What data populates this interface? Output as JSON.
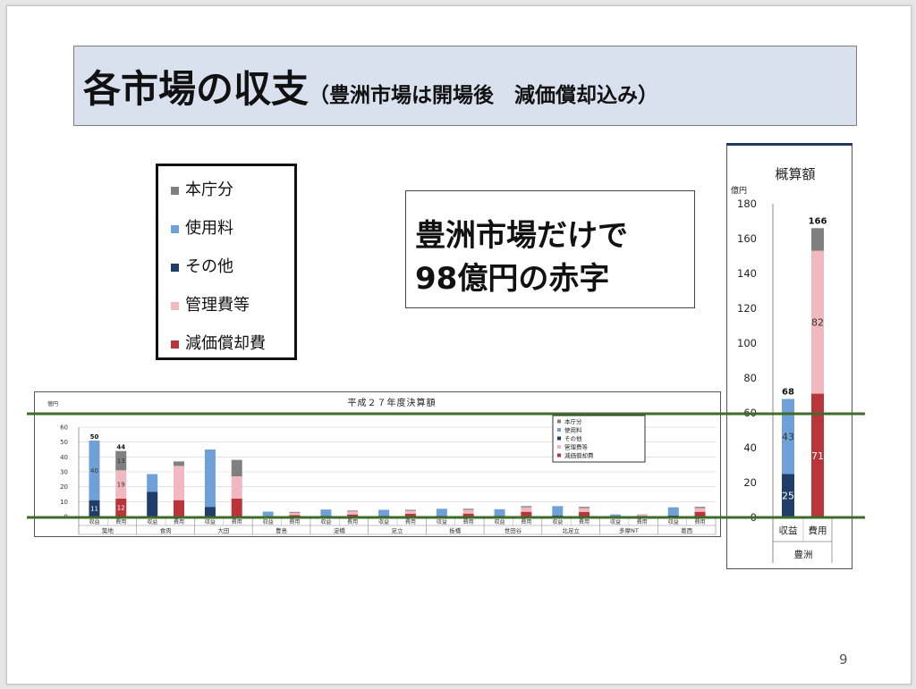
{
  "title": {
    "main": "各市場の収支",
    "sub": "（豊洲市場は開場後　減価償却込み）"
  },
  "legend": {
    "items": [
      {
        "label": "本庁分",
        "color": "#7f7f7f"
      },
      {
        "label": "使用料",
        "color": "#6fa0d8"
      },
      {
        "label": "その他",
        "color": "#1f3d66"
      },
      {
        "label": "管理費等",
        "color": "#f1b9bf"
      },
      {
        "label": "減価償却費",
        "color": "#b9353a"
      }
    ]
  },
  "callout": {
    "line1": "豊洲市場だけで",
    "line2": "98億円の赤字"
  },
  "page_number": "9",
  "chart_data": [
    {
      "type": "bar",
      "stacked": true,
      "title": "平成２７年度決算額",
      "unit": "億円",
      "ylim": [
        0,
        60
      ],
      "yticks": [
        0,
        10,
        20,
        30,
        40,
        50,
        60
      ],
      "yticklabels": [
        "0",
        "10",
        "20",
        "30",
        "40",
        "50",
        "60"
      ],
      "legend": [
        "本庁分",
        "使用料",
        "その他",
        "管理費等",
        "減価償却費"
      ],
      "bar_labels": [
        "収益",
        "費用"
      ],
      "markets": [
        {
          "name": "築地",
          "revenue": {
            "その他": 11,
            "使用料": 40
          },
          "expense": {
            "減価償却費": 12,
            "管理費等": 19,
            "本庁分": 13
          },
          "revenue_total": "50",
          "expense_total": "44",
          "segment_labels": {
            "revenue": {
              "その他": "11",
              "使用料": "40"
            },
            "expense": {
              "減価償却費": "12",
              "管理費等": "19",
              "本庁分": "13"
            }
          }
        },
        {
          "name": "食肉",
          "revenue": {
            "その他": 16.5,
            "使用料": 12
          },
          "expense": {
            "減価償却費": 11,
            "管理費等": 23,
            "本庁分": 3
          }
        },
        {
          "name": "大田",
          "revenue": {
            "その他": 6.5,
            "使用料": 38.5
          },
          "expense": {
            "減価償却費": 12,
            "管理費等": 15,
            "本庁分": 11
          }
        },
        {
          "name": "豊島",
          "revenue": {
            "その他": 0.4,
            "使用料": 2.9
          },
          "expense": {
            "減価償却費": 1,
            "管理費等": 1.5,
            "本庁分": 0.6
          }
        },
        {
          "name": "淀橋",
          "revenue": {
            "その他": 0.5,
            "使用料": 4.2
          },
          "expense": {
            "減価償却費": 1.4,
            "管理費等": 2,
            "本庁分": 0.6
          }
        },
        {
          "name": "足立",
          "revenue": {
            "その他": 0.5,
            "使用料": 4
          },
          "expense": {
            "減価償却費": 1.8,
            "管理費等": 2.1,
            "本庁分": 0.6
          }
        },
        {
          "name": "板橋",
          "revenue": {
            "その他": 0.5,
            "使用料": 4.7
          },
          "expense": {
            "減価償却費": 2,
            "管理費等": 2.5,
            "本庁分": 0.7
          }
        },
        {
          "name": "世田谷",
          "revenue": {
            "その他": 0.5,
            "使用料": 4.4
          },
          "expense": {
            "減価償却費": 3.2,
            "管理費等": 3,
            "本庁分": 0.8
          }
        },
        {
          "name": "北足立",
          "revenue": {
            "その他": 0.6,
            "使用料": 6.4
          },
          "expense": {
            "減価償却費": 3,
            "管理費等": 2.7,
            "本庁分": 0.8
          }
        },
        {
          "name": "多摩NT",
          "revenue": {
            "その他": 0.2,
            "使用料": 1.2
          },
          "expense": {
            "減価償却費": 0.5,
            "管理費等": 0.7,
            "本庁分": 0.2
          }
        },
        {
          "name": "葛西",
          "revenue": {
            "その他": 0.6,
            "使用料": 5.6
          },
          "expense": {
            "減価償却費": 3.2,
            "管理費等": 2.5,
            "本庁分": 0.8
          }
        }
      ]
    },
    {
      "type": "bar",
      "stacked": true,
      "title": "概算額",
      "unit": "億円",
      "ylim": [
        0,
        180
      ],
      "yticks": [
        0,
        20,
        40,
        60,
        80,
        100,
        120,
        140,
        160,
        180
      ],
      "yticklabels": [
        "0",
        "20",
        "40",
        "60",
        "80",
        "100",
        "120",
        "140",
        "160",
        "180"
      ],
      "category": "豊洲",
      "bars": [
        {
          "label": "収益",
          "segments": [
            {
              "series": "その他",
              "value": 25,
              "label": "25"
            },
            {
              "series": "使用料",
              "value": 43,
              "label": "43"
            }
          ],
          "total": "68"
        },
        {
          "label": "費用",
          "segments": [
            {
              "series": "減価償却費",
              "value": 71,
              "label": "71"
            },
            {
              "series": "管理費等",
              "value": 82,
              "label": "82"
            },
            {
              "series": "本庁分",
              "value": 13
            }
          ],
          "total": "166"
        }
      ]
    }
  ]
}
